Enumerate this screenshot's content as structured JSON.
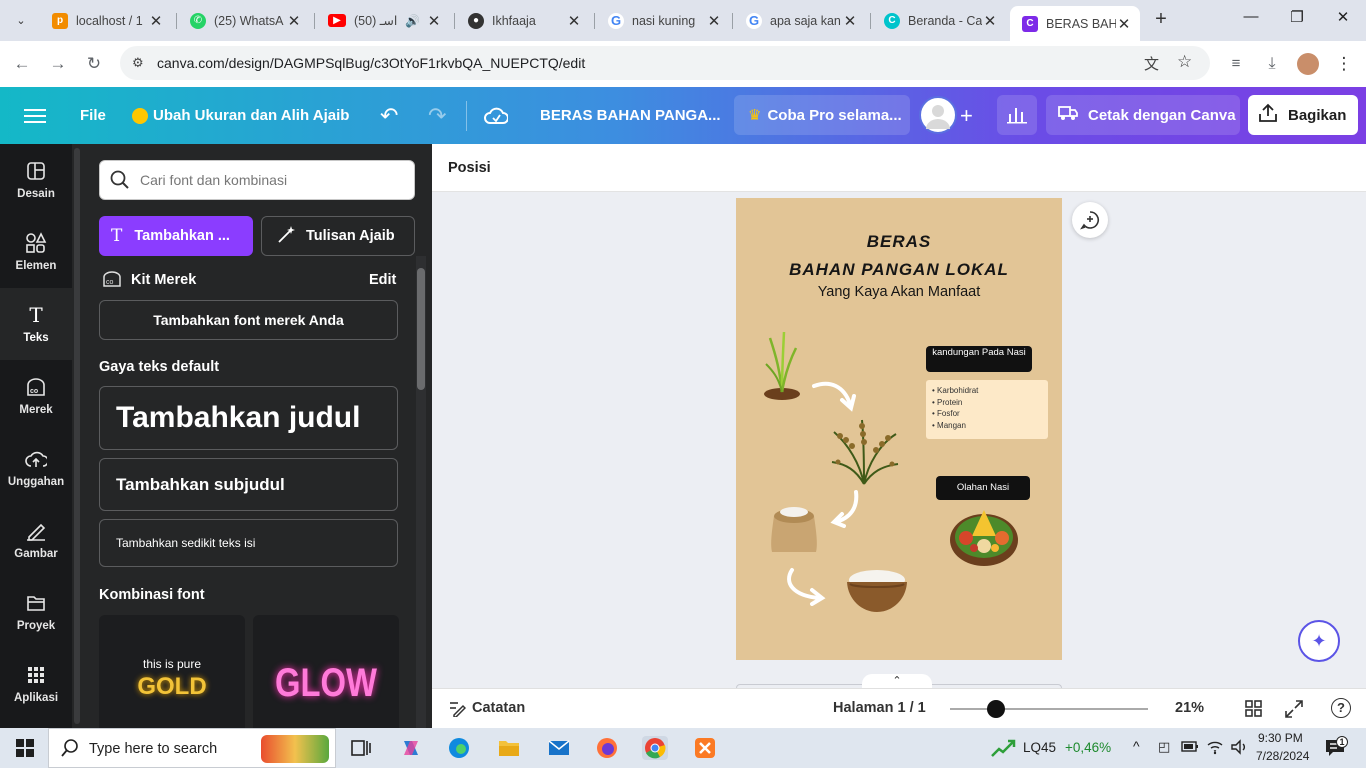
{
  "browser": {
    "tabs": [
      {
        "label": "localhost / 1",
        "icon": "phpmyadmin-icon",
        "color": "#f28c00"
      },
      {
        "label": "(25) WhatsA",
        "icon": "whatsapp-icon",
        "color": "#25d366"
      },
      {
        "label": "اسـ (50)",
        "icon": "youtube-icon",
        "color": "#ff0000"
      },
      {
        "label": "Ikhfaaja",
        "icon": "github-icon",
        "color": "#333333"
      },
      {
        "label": "nasi kuning",
        "icon": "google-icon",
        "color": "#4285f4"
      },
      {
        "label": "apa saja kan",
        "icon": "google-icon",
        "color": "#4285f4"
      },
      {
        "label": "Beranda - Ca",
        "icon": "canva-icon",
        "color": "#00c4cc"
      },
      {
        "label": "BERAS BAHA",
        "icon": "canva-icon",
        "color": "#7d2ae8"
      }
    ],
    "url": "canva.com/design/DAGMPSqlBug/c3OtYoF1rkvbQA_NUEPCTQ/edit"
  },
  "canva_bar": {
    "file": "File",
    "magic_resize": "Ubah Ukuran dan Alih Ajaib",
    "design_title": "BERAS BAHAN PANGA...",
    "pro": "Coba Pro selama...",
    "print": "Cetak dengan Canva",
    "share": "Bagikan"
  },
  "rail": [
    {
      "label": "Desain",
      "icon": "layout-icon"
    },
    {
      "label": "Elemen",
      "icon": "shapes-icon"
    },
    {
      "label": "Teks",
      "icon": "text-icon"
    },
    {
      "label": "Merek",
      "icon": "brand-icon"
    },
    {
      "label": "Unggahan",
      "icon": "upload-cloud-icon"
    },
    {
      "label": "Gambar",
      "icon": "draw-icon"
    },
    {
      "label": "Proyek",
      "icon": "folder-icon"
    },
    {
      "label": "Aplikasi",
      "icon": "apps-grid-icon"
    }
  ],
  "panel": {
    "search_placeholder": "Cari font dan kombinasi",
    "add_text_button": "Tambahkan ...",
    "magic_write_button": "Tulisan Ajaib",
    "brand_kit": "Kit Merek",
    "brand_edit": "Edit",
    "add_brand_font": "Tambahkan font merek Anda",
    "default_styles": "Gaya teks default",
    "heading": "Tambahkan judul",
    "subheading": "Tambahkan subjudul",
    "body": "Tambahkan sedikit teks isi",
    "font_combos": "Kombinasi font",
    "combo1_small": "this is pure",
    "combo1_big": "GOLD",
    "combo2": "GLOW"
  },
  "workspace": {
    "toolbar_label": "Posisi",
    "design": {
      "title1": "BERAS",
      "title2": "BAHAN PANGAN LOKAL",
      "subtitle": "Yang Kaya Akan Manfaat",
      "label_kandungan": "kandungan Pada Nasi",
      "nutrients": [
        "Karbohidrat",
        "Protein",
        "Fosfor",
        "Mangan"
      ],
      "label_olahan": "Olahan Nasi"
    }
  },
  "bottom": {
    "notes": "Catatan",
    "page": "Halaman 1 / 1",
    "zoom": "21%",
    "zoom_level_percent": 21
  },
  "taskbar": {
    "search_placeholder": "Type here to search",
    "stock_name": "LQ45",
    "stock_change": "+0,46%",
    "time": "9:30 PM",
    "date": "7/28/2024"
  }
}
